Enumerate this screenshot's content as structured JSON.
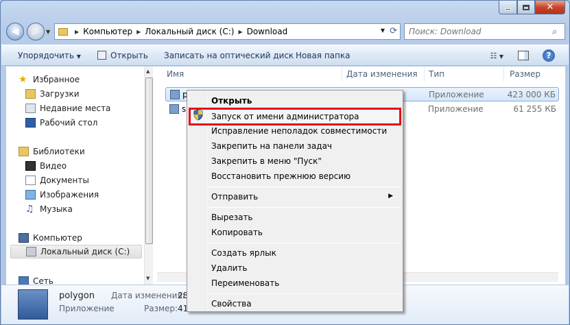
{
  "window": {
    "close_glyph": "✕"
  },
  "nav": {
    "address_crumbs": [
      "Компьютер",
      "Локальный диск (C:)",
      "Download"
    ],
    "search_placeholder": "Поиск: Download"
  },
  "toolbar": {
    "organize": "Упорядочить",
    "open": "Открыть",
    "burn": "Записать на оптический диск",
    "new_folder": "Новая папка",
    "help": "?"
  },
  "sidebar": {
    "favorites": {
      "title": "Избранное",
      "items": [
        "Загрузки",
        "Недавние места",
        "Рабочий стол"
      ]
    },
    "libraries": {
      "title": "Библиотеки",
      "items": [
        "Видео",
        "Документы",
        "Изображения",
        "Музыка"
      ]
    },
    "computer": {
      "title": "Компьютер",
      "items": [
        "Локальный диск (C:)"
      ]
    },
    "network": {
      "title": "Сеть"
    }
  },
  "file_list": {
    "columns": [
      "Имя",
      "Дата изменения",
      "Тип",
      "Размер"
    ],
    "rows": [
      {
        "name": "p",
        "type": "Приложение",
        "size": "423 000 КБ",
        "selected": true
      },
      {
        "name": "s",
        "type": "Приложение",
        "size": "61 255 КБ",
        "selected": false
      }
    ]
  },
  "details": {
    "name": "polygon",
    "kind": "Приложение",
    "date_label": "Дата изменения:",
    "date_value": "28",
    "size_label": "Размер:",
    "size_value": "41"
  },
  "context_menu": {
    "items": [
      {
        "label": "Открыть",
        "bold": true
      },
      {
        "label": "Запуск от имени администратора",
        "highlight": true,
        "icon": "shield-icon"
      },
      {
        "label": "Исправление неполадок совместимости"
      },
      {
        "label": "Закрепить на панели задач"
      },
      {
        "label": "Закрепить в меню \"Пуск\""
      },
      {
        "label": "Восстановить прежнюю версию"
      },
      {
        "label": "Отправить",
        "submenu": true
      },
      {
        "label": "Вырезать"
      },
      {
        "label": "Копировать"
      },
      {
        "label": "Создать ярлык"
      },
      {
        "label": "Удалить"
      },
      {
        "label": "Переименовать"
      },
      {
        "label": "Свойства"
      }
    ]
  },
  "colors": {
    "highlight_border": "#e01017",
    "close_button": "#c9452c"
  }
}
